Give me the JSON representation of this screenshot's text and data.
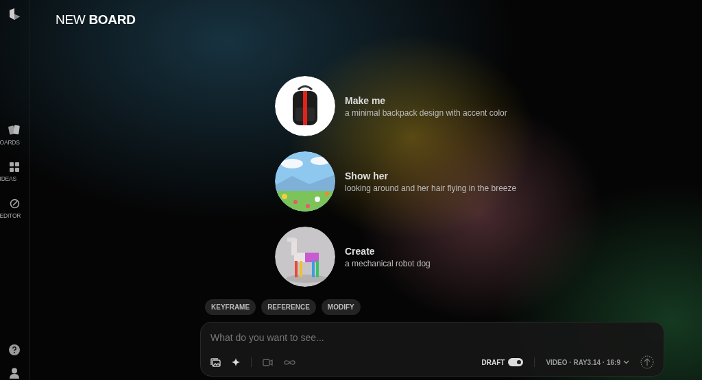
{
  "sidebar": {
    "items": [
      {
        "label": "OARDS",
        "kind": "boards"
      },
      {
        "label": "IDEAS",
        "kind": "ideas"
      },
      {
        "label": "EDITOR",
        "kind": "editor"
      }
    ]
  },
  "header": {
    "title": "NEW **BOARD**"
  },
  "suggestions": [
    {
      "title": "Make me",
      "text": "a minimal backpack design with accent color",
      "kind": "picture"
    },
    {
      "title": "Show her",
      "text": "looking around and her hair flying in the breeze",
      "kind": "picture"
    },
    {
      "title": "Create",
      "text": "a mechanical robot dog",
      "kind": "picture"
    }
  ],
  "chips": [
    "KEYFRAME",
    "REFERENCE",
    "MODIFY"
  ],
  "prompt": {
    "placeholder": "What do you want to see...",
    "draft_label": "DRAFT",
    "draft_on": true,
    "settings": "VIDEO · RAY3.14 · 16:9"
  }
}
